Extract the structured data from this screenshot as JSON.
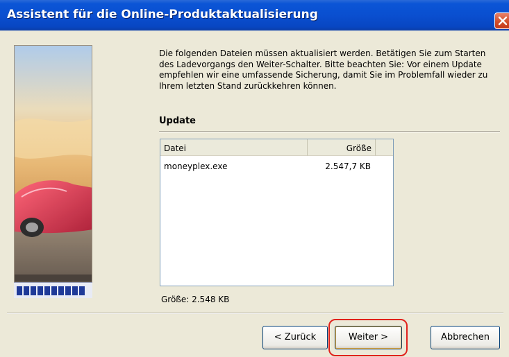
{
  "window": {
    "title": "Assistent für die Online-Produktaktualisierung"
  },
  "main": {
    "intro_text": "Die folgenden Dateien müssen aktualisiert werden. Betätigen Sie zum Starten des Ladevorgangs den Weiter-Schalter. Bitte beachten Sie: Vor einem Update empfehlen wir eine umfassende Sicherung, damit Sie im Problemfall wieder zu Ihrem letzten Stand zurückkehren können.",
    "section_title": "Update",
    "file_list": {
      "columns": [
        "Datei",
        "Größe"
      ],
      "rows": [
        {
          "file": "moneyplex.exe",
          "size": "2.547,7 KB"
        }
      ]
    },
    "total_size": "Größe: 2.548 KB"
  },
  "buttons": {
    "back": "< Zurück",
    "next": "Weiter >",
    "cancel": "Abbrechen"
  },
  "colors": {
    "titlebar": "#0a4fd0",
    "highlight": "#e0221c",
    "progress": "#1f3a98"
  }
}
